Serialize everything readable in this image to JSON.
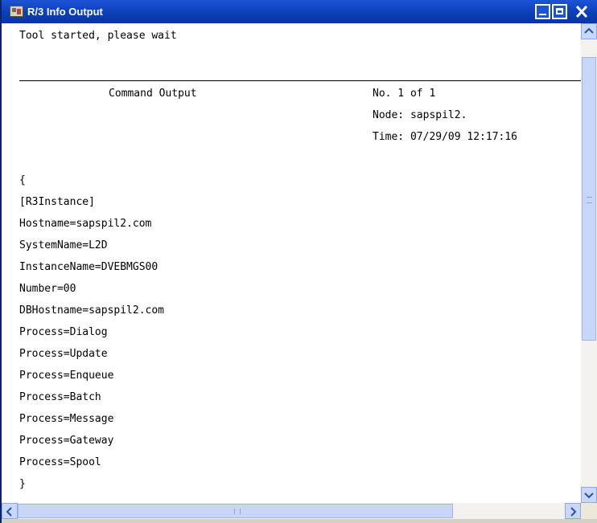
{
  "window": {
    "title": "R/3 Info Output",
    "app_icon": "r3-window-icon",
    "controls": [
      "minimize-icon",
      "maximize-icon",
      "close-icon"
    ]
  },
  "output": {
    "status": "Tool started, please wait",
    "header": {
      "label": "Command Output",
      "count": "No. 1 of 1",
      "node": "Node: sapspil2.",
      "time": "Time: 07/29/09 12:17:16"
    },
    "lines": [
      "{",
      "[R3Instance]",
      "Hostname=sapspil2.com",
      "SystemName=L2D",
      "InstanceName=DVEBMGS00",
      "Number=00",
      "DBHostname=sapspil2.com",
      "Process=Dialog",
      "Process=Update",
      "Process=Enqueue",
      "Process=Batch",
      "Process=Message",
      "Process=Gateway",
      "Process=Spool",
      "}"
    ]
  },
  "colors": {
    "titlebar": "#0b3fb8",
    "scroll_thumb": "#c8d6f8"
  }
}
